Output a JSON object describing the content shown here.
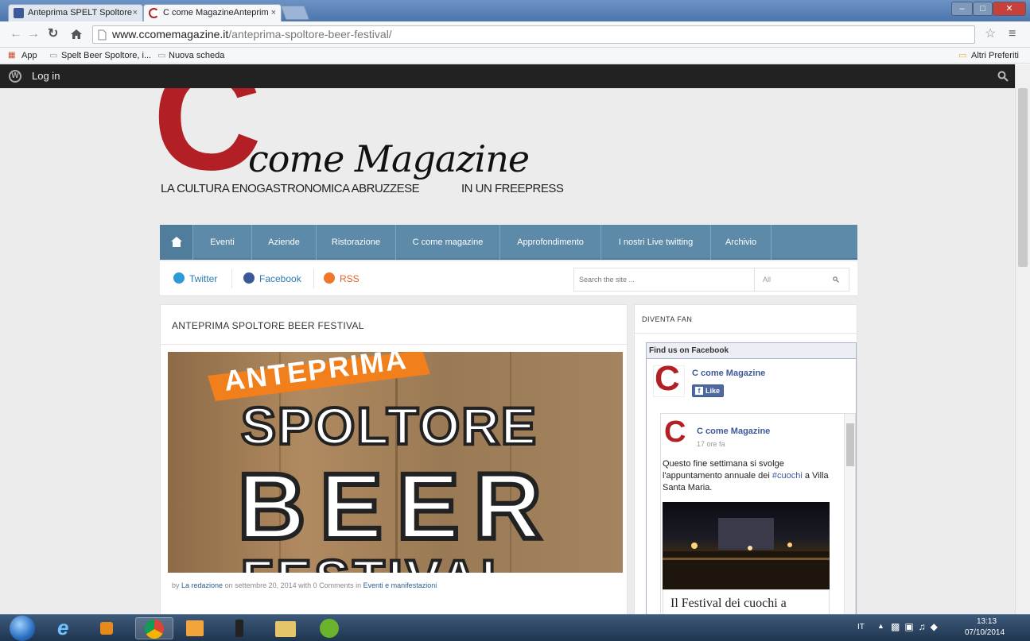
{
  "browser": {
    "tabs": [
      {
        "title": "Anteprima SPELT Spoltore",
        "favicon_color": "#3b5998"
      },
      {
        "title": "C come MagazineAnteprim",
        "favicon_color": "#b21f24"
      }
    ],
    "tab_close": "×",
    "url_host": "www.ccomemagazine.it",
    "url_path": "/anteprima-spoltore-beer-festival/",
    "bookmarks": [
      "App",
      "Spelt Beer Spoltore, i...",
      "Nuova scheda"
    ],
    "other_bookmarks": "Altri Preferiti",
    "window_controls": [
      "–",
      "□",
      "✕"
    ]
  },
  "wp_admin": {
    "login_label": "Log in"
  },
  "site": {
    "logo_letter": "C",
    "logo_script": "come Magazine",
    "tagline_left": "LA CULTURA ENOGASTRONOMICA ABRUZZESE",
    "tagline_right": "IN UN FREEPRESS",
    "brand_red": "#b21f24",
    "nav_color": "#5c8aa8",
    "nav_items": [
      "Eventi",
      "Aziende",
      "Ristorazione",
      "C come magazine",
      "Approfondimento",
      "I nostri Live twitting",
      "Archivio"
    ],
    "social": [
      {
        "label": "Twitter",
        "color": "#2b9ad6"
      },
      {
        "label": "Facebook",
        "color": "#3b5998"
      },
      {
        "label": "RSS",
        "color": "#f0762b"
      }
    ],
    "search_placeholder": "Search the site ...",
    "search_scope": "All"
  },
  "post": {
    "title": "ANTEPRIMA SPOLTORE BEER FESTIVAL",
    "image_words": [
      "ANTEPRIMA",
      "SPOLTORE",
      "BEER",
      "FESTIVAL"
    ],
    "meta_by": "by ",
    "meta_author": "La redazione",
    "meta_on": " on settembre 20, 2014 with 0 Comments in ",
    "meta_category": "Eventi e manifestazioni"
  },
  "sidebar": {
    "widget_title": "DIVENTA FAN",
    "fb_header": "Find us on Facebook",
    "page_name": "C come Magazine",
    "like_label": "Like",
    "post_author": "C come Magazine",
    "post_time": "17 ore fa",
    "post_text_1": "Questo fine settimana si svolge l'appuntamento annuale dei ",
    "post_hashtag": "#cuochi",
    "post_text_2": " a Villa Santa Maria.",
    "post_link_title": "Il Festival dei cuochi a"
  },
  "taskbar": {
    "lang": "IT",
    "time": "13:13",
    "date": "07/10/2014"
  }
}
